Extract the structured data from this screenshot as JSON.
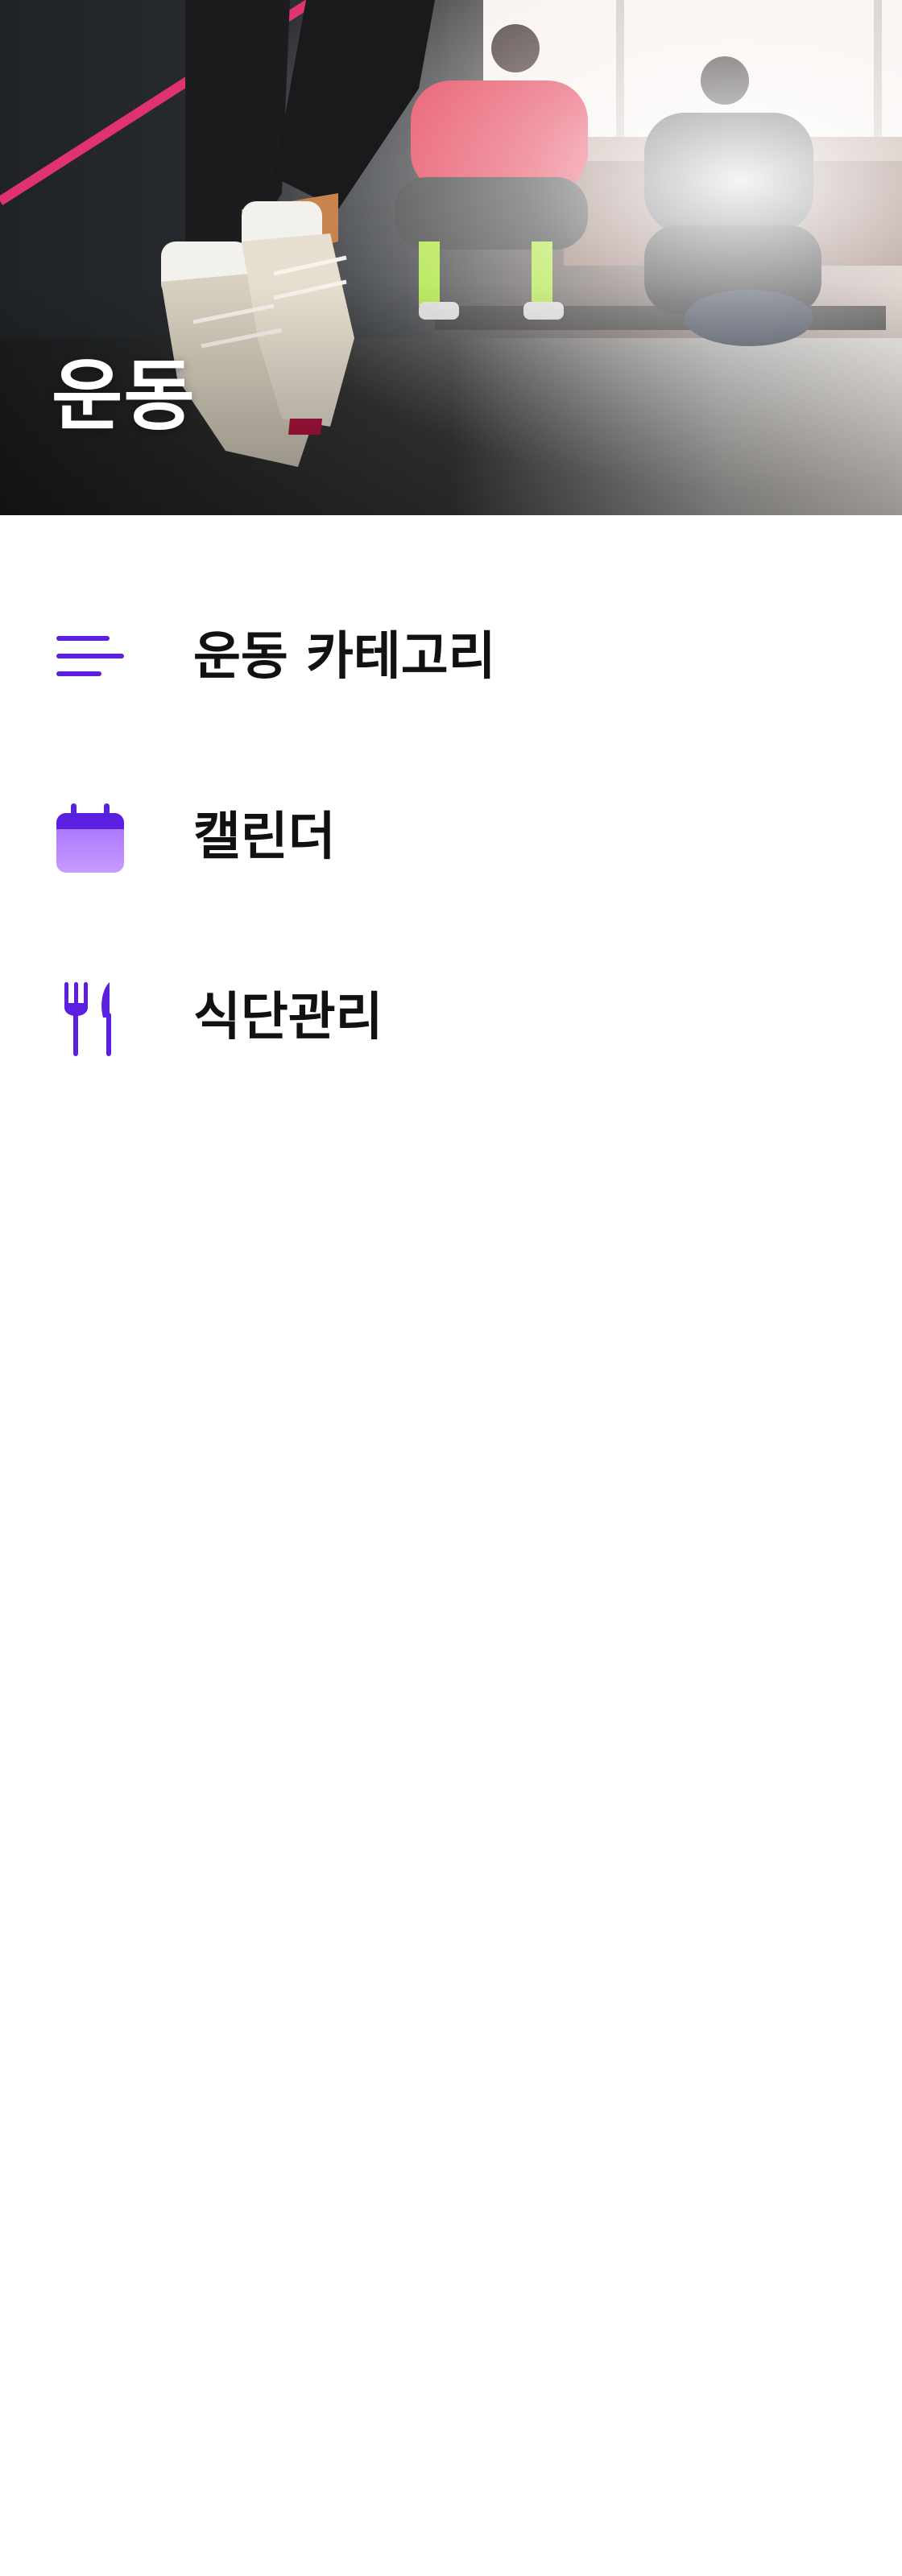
{
  "header": {
    "title": "운동",
    "background_image": "gym-workout-photo"
  },
  "menu": {
    "items": [
      {
        "label": "운동 카테고리",
        "icon": "menu-lines-icon"
      },
      {
        "label": "캘린더",
        "icon": "calendar-icon"
      },
      {
        "label": "식단관리",
        "icon": "fork-knife-icon"
      }
    ]
  },
  "colors": {
    "accent": "#5b1fe0",
    "accent_light": "#b98bff",
    "text": "#111111",
    "background": "#ffffff"
  }
}
